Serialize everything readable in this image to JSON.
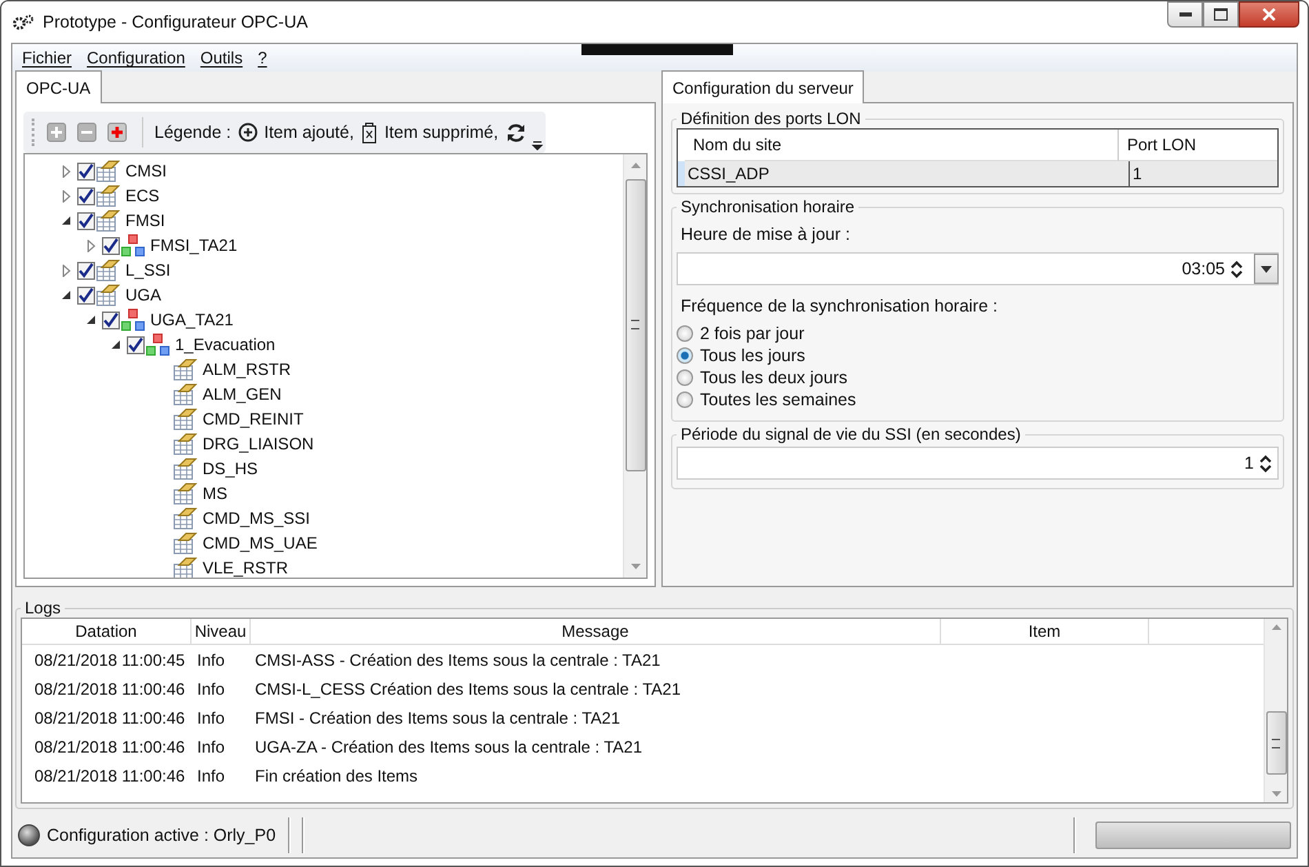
{
  "window": {
    "title": "Prototype - Configurateur OPC-UA"
  },
  "menu": [
    {
      "label": "Fichier"
    },
    {
      "label": "Configuration"
    },
    {
      "label": "Outils"
    },
    {
      "label": "?"
    }
  ],
  "left_panel": {
    "tabs": [
      {
        "label": "OPC-UA",
        "selected": true
      }
    ],
    "toolbar": {
      "legend_label": "Légende :",
      "legend": [
        {
          "kind": "added",
          "label": "Item ajouté,"
        },
        {
          "kind": "deleted",
          "label": "Item supprimé,"
        },
        {
          "kind": "refresh"
        }
      ]
    },
    "tree": [
      {
        "label": "CMSI",
        "kind": "group",
        "checked": true,
        "expanded": false
      },
      {
        "label": "ECS",
        "kind": "group",
        "checked": true,
        "expanded": false
      },
      {
        "label": "FMSI",
        "kind": "group",
        "checked": true,
        "expanded": true,
        "children": [
          {
            "label": "FMSI_TA21",
            "kind": "station",
            "checked": true,
            "expanded": false
          }
        ]
      },
      {
        "label": "L_SSI",
        "kind": "group",
        "checked": true,
        "expanded": false
      },
      {
        "label": "UGA",
        "kind": "group",
        "checked": true,
        "expanded": true,
        "children": [
          {
            "label": "UGA_TA21",
            "kind": "station",
            "checked": true,
            "expanded": true,
            "children": [
              {
                "label": "1_Evacuation",
                "kind": "station",
                "checked": true,
                "expanded": true,
                "children": [
                  {
                    "label": "ALM_RSTR",
                    "kind": "item"
                  },
                  {
                    "label": "ALM_GEN",
                    "kind": "item"
                  },
                  {
                    "label": "CMD_REINIT",
                    "kind": "item"
                  },
                  {
                    "label": "DRG_LIAISON",
                    "kind": "item"
                  },
                  {
                    "label": "DS_HS",
                    "kind": "item"
                  },
                  {
                    "label": "MS",
                    "kind": "item"
                  },
                  {
                    "label": "CMD_MS_SSI",
                    "kind": "item"
                  },
                  {
                    "label": "CMD_MS_UAE",
                    "kind": "item"
                  },
                  {
                    "label": "VLE_RSTR",
                    "kind": "item"
                  }
                ]
              }
            ]
          }
        ]
      }
    ]
  },
  "right_panel": {
    "tabs": [
      {
        "label": "Configuration du serveur",
        "selected": true
      }
    ],
    "lon_ports": {
      "title": "Définition des ports LON",
      "columns": [
        "Nom du site",
        "Port LON"
      ],
      "rows": [
        [
          "CSSI_ADP",
          "1"
        ]
      ]
    },
    "sync": {
      "title": "Synchronisation horaire",
      "time_label": "Heure de mise à jour :",
      "time_value": "03:05",
      "frequency_label": "Fréquence de la synchronisation horaire :",
      "options": [
        {
          "label": "2 fois par jour",
          "selected": false
        },
        {
          "label": "Tous les jours",
          "selected": true
        },
        {
          "label": "Tous les deux jours",
          "selected": false
        },
        {
          "label": "Toutes les semaines",
          "selected": false
        }
      ]
    },
    "heartbeat": {
      "title": "Période du signal de vie du SSI (en secondes)",
      "value": "1"
    }
  },
  "logs": {
    "title": "Logs",
    "columns": [
      "Datation",
      "Niveau",
      "Message",
      "Item"
    ],
    "rows": [
      [
        "08/21/2018 11:00:45",
        "Info",
        "CMSI-ASS - Création des Items sous la centrale : TA21",
        ""
      ],
      [
        "08/21/2018 11:00:46",
        "Info",
        "CMSI-L_CESS Création des Items sous la centrale : TA21",
        ""
      ],
      [
        "08/21/2018 11:00:46",
        "Info",
        "FMSI - Création des Items sous la centrale : TA21",
        ""
      ],
      [
        "08/21/2018 11:00:46",
        "Info",
        "UGA-ZA - Création des Items sous la centrale : TA21",
        ""
      ],
      [
        "08/21/2018 11:00:46",
        "Info",
        "Fin création des Items",
        ""
      ]
    ]
  },
  "status_bar": {
    "text": "Configuration active : Orly_P0",
    "progress": {
      "level": 0
    }
  }
}
